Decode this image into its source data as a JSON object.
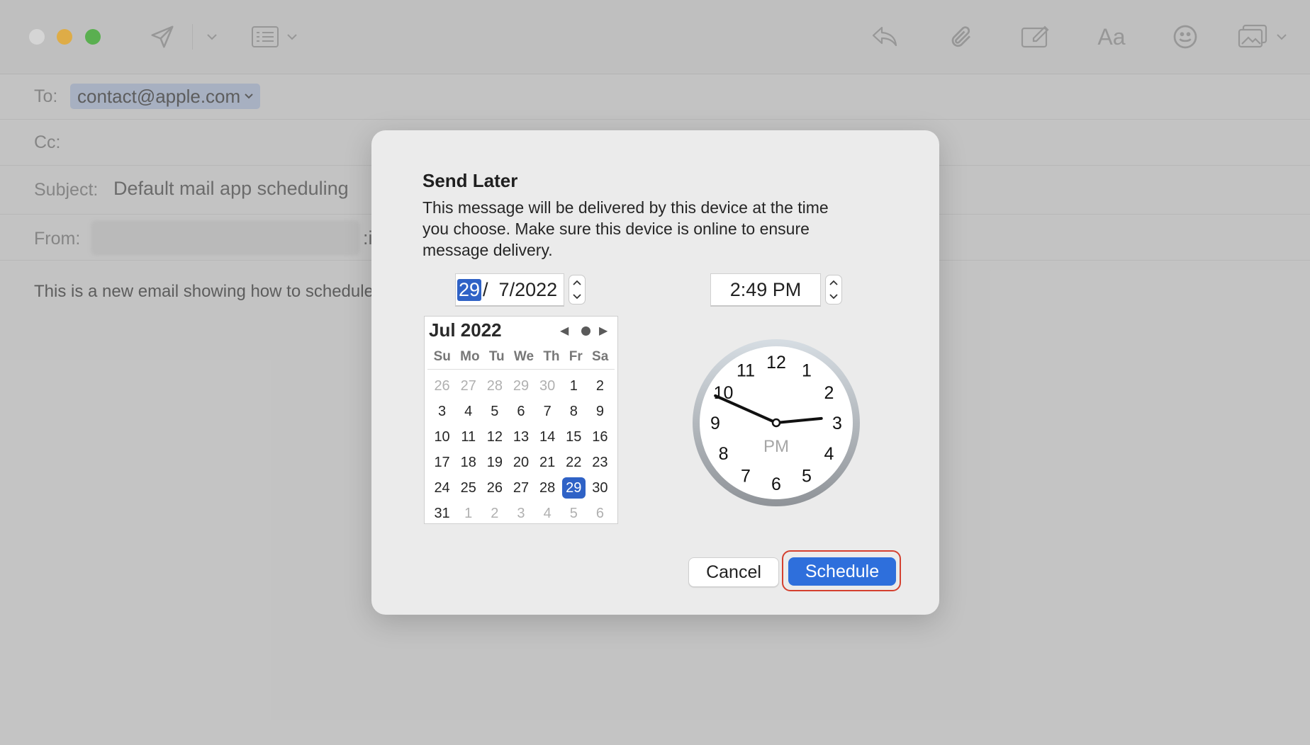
{
  "mail": {
    "to_label": "To:",
    "to_value": "contact@apple.com",
    "cc_label": "Cc:",
    "subject_label": "Subject:",
    "subject_value": "Default mail app scheduling",
    "from_label": "From:",
    "from_trailing": ":i",
    "body_text": "This is a new email showing how to schedule"
  },
  "toolbar": {
    "icons": [
      "send-icon",
      "chevron-down-icon",
      "header-fields-icon",
      "reply-icon",
      "attachment-icon",
      "markup-icon",
      "format-icon",
      "emoji-icon",
      "photo-browser-icon"
    ],
    "format_label": "Aa"
  },
  "dialog": {
    "title": "Send Later",
    "description": "This message will be delivered by this device at the time you choose. Make sure this device is online to ensure message delivery.",
    "date_day": "29",
    "date_rest": "/  7/2022",
    "time": "2:49 PM",
    "cancel_label": "Cancel",
    "schedule_label": "Schedule"
  },
  "calendar": {
    "title": "Jul 2022",
    "days_of_week": [
      "Su",
      "Mo",
      "Tu",
      "We",
      "Th",
      "Fr",
      "Sa"
    ],
    "prev_symbol": "◀",
    "next_symbol": "▶",
    "weeks": [
      [
        "26",
        "27",
        "28",
        "29",
        "30",
        "1",
        "2"
      ],
      [
        "3",
        "4",
        "5",
        "6",
        "7",
        "8",
        "9"
      ],
      [
        "10",
        "11",
        "12",
        "13",
        "14",
        "15",
        "16"
      ],
      [
        "17",
        "18",
        "19",
        "20",
        "21",
        "22",
        "23"
      ],
      [
        "24",
        "25",
        "26",
        "27",
        "28",
        "29",
        "30"
      ],
      [
        "31",
        "1",
        "2",
        "3",
        "4",
        "5",
        "6"
      ]
    ],
    "muted": [
      [
        true,
        true,
        true,
        true,
        true,
        false,
        false
      ],
      [
        false,
        false,
        false,
        false,
        false,
        false,
        false
      ],
      [
        false,
        false,
        false,
        false,
        false,
        false,
        false
      ],
      [
        false,
        false,
        false,
        false,
        false,
        false,
        false
      ],
      [
        false,
        false,
        false,
        false,
        false,
        false,
        false
      ],
      [
        false,
        true,
        true,
        true,
        true,
        true,
        true
      ]
    ],
    "selected": {
      "week": 4,
      "day": 5
    }
  },
  "clock": {
    "numbers": [
      "12",
      "1",
      "2",
      "3",
      "4",
      "5",
      "6",
      "7",
      "8",
      "9",
      "10",
      "11"
    ],
    "period": "PM",
    "hour": 2,
    "minute": 49
  },
  "colors": {
    "accent": "#2e6fdc",
    "selection": "#2f62c6",
    "highlight_ring": "#d4402f"
  }
}
